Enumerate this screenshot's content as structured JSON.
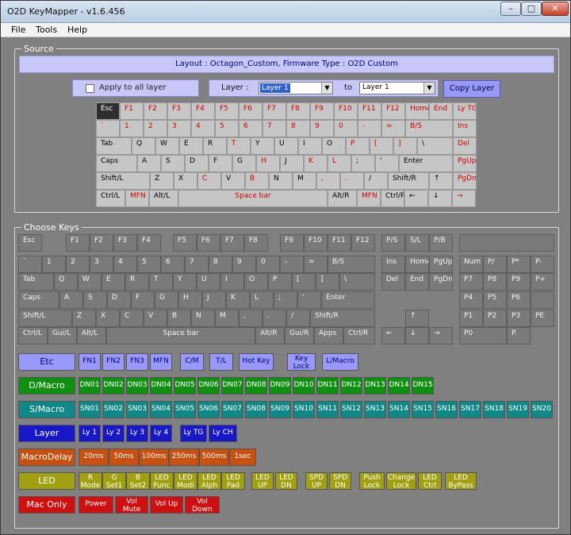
{
  "window": {
    "title": "O2D KeyMapper - v1.6.456"
  },
  "menu": [
    "File",
    "Tools",
    "Help"
  ],
  "source": {
    "caption": "Source",
    "layout_text": "Layout : Octagon_Custom,  Firmware Type : O2D Custom",
    "apply_all_label": "Apply to all layer",
    "layer_label": "Layer :",
    "layer_value": "Layer 1",
    "to_label": "to",
    "to_value": "Layer 1",
    "copy_button": "Copy Layer"
  },
  "choose": {
    "caption": "Choose Keys"
  },
  "colors": {
    "lavender": "#9898f8",
    "green": "#109010",
    "teal": "#108888",
    "blue": "#1818c8",
    "orange": "#c85010",
    "olive": "#a0a010",
    "red": "#d01010"
  }
}
